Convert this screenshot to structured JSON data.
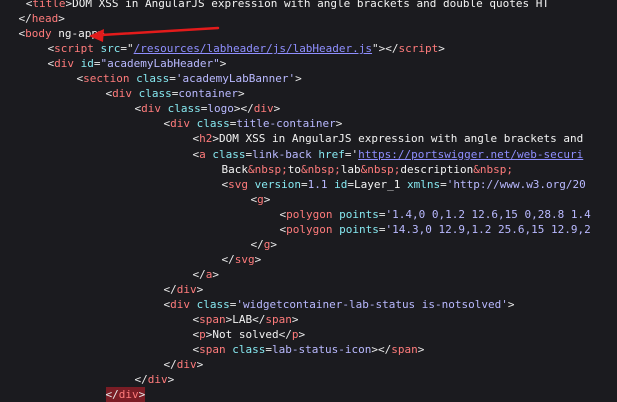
{
  "lines": [
    {
      "indent": 3,
      "name": "line-title",
      "tokens": [
        {
          "t": "punct",
          "v": "<"
        },
        {
          "t": "tag",
          "v": "title"
        },
        {
          "t": "punct",
          "v": ">"
        },
        {
          "t": "text",
          "v": "DOM XSS in AngularJS expression with angle brackets and double quotes HT"
        }
      ]
    },
    {
      "indent": 2,
      "name": "line-head-close",
      "tokens": [
        {
          "t": "punct",
          "v": "</"
        },
        {
          "t": "tag",
          "v": "head"
        },
        {
          "t": "punct",
          "v": ">"
        }
      ]
    },
    {
      "indent": 2,
      "name": "line-body-open",
      "tokens": [
        {
          "t": "punct",
          "v": "<"
        },
        {
          "t": "tag",
          "v": "body"
        },
        {
          "t": "text",
          "v": " ng-app"
        },
        {
          "t": "punct",
          "v": ">"
        }
      ]
    },
    {
      "indent": 6,
      "name": "line-script",
      "tokens": [
        {
          "t": "punct",
          "v": "<"
        },
        {
          "t": "tag",
          "v": "script"
        },
        {
          "t": "attr",
          "v": " src"
        },
        {
          "t": "punct",
          "v": "=\""
        },
        {
          "t": "link",
          "v": "/resources/labheader/js/labHeader.js"
        },
        {
          "t": "punct",
          "v": "\"></"
        },
        {
          "t": "tag",
          "v": "script"
        },
        {
          "t": "punct",
          "v": ">"
        }
      ]
    },
    {
      "indent": 6,
      "name": "line-div-academy",
      "tokens": [
        {
          "t": "punct",
          "v": "<"
        },
        {
          "t": "tag",
          "v": "div"
        },
        {
          "t": "attr",
          "v": " id"
        },
        {
          "t": "punct",
          "v": "="
        },
        {
          "t": "val",
          "v": "\"academyLabHeader\""
        },
        {
          "t": "punct",
          "v": ">"
        }
      ]
    },
    {
      "indent": 10,
      "name": "line-section",
      "tokens": [
        {
          "t": "punct",
          "v": "<"
        },
        {
          "t": "tag",
          "v": "section"
        },
        {
          "t": "attr",
          "v": " class"
        },
        {
          "t": "punct",
          "v": "="
        },
        {
          "t": "val",
          "v": "'academyLabBanner'"
        },
        {
          "t": "punct",
          "v": ">"
        }
      ]
    },
    {
      "indent": 14,
      "name": "line-div-container",
      "tokens": [
        {
          "t": "punct",
          "v": "<"
        },
        {
          "t": "tag",
          "v": "div"
        },
        {
          "t": "attr",
          "v": " class"
        },
        {
          "t": "punct",
          "v": "="
        },
        {
          "t": "val",
          "v": "container"
        },
        {
          "t": "punct",
          "v": ">"
        }
      ]
    },
    {
      "indent": 18,
      "name": "line-div-logo",
      "tokens": [
        {
          "t": "punct",
          "v": "<"
        },
        {
          "t": "tag",
          "v": "div"
        },
        {
          "t": "attr",
          "v": " class"
        },
        {
          "t": "punct",
          "v": "="
        },
        {
          "t": "val",
          "v": "logo"
        },
        {
          "t": "punct",
          "v": "></"
        },
        {
          "t": "tag",
          "v": "div"
        },
        {
          "t": "punct",
          "v": ">"
        }
      ]
    },
    {
      "indent": 22,
      "name": "line-div-title-container",
      "tokens": [
        {
          "t": "punct",
          "v": "<"
        },
        {
          "t": "tag",
          "v": "div"
        },
        {
          "t": "attr",
          "v": " class"
        },
        {
          "t": "punct",
          "v": "="
        },
        {
          "t": "val",
          "v": "title-container"
        },
        {
          "t": "punct",
          "v": ">"
        }
      ]
    },
    {
      "indent": 26,
      "name": "line-h2",
      "tokens": [
        {
          "t": "punct",
          "v": "<"
        },
        {
          "t": "tag",
          "v": "h2"
        },
        {
          "t": "punct",
          "v": ">"
        },
        {
          "t": "text",
          "v": "DOM XSS in AngularJS expression with angle brackets and"
        }
      ]
    },
    {
      "indent": 26,
      "name": "line-a-link-back",
      "tokens": [
        {
          "t": "punct",
          "v": "<"
        },
        {
          "t": "tag",
          "v": "a"
        },
        {
          "t": "attr",
          "v": " class"
        },
        {
          "t": "punct",
          "v": "="
        },
        {
          "t": "val",
          "v": "link-back"
        },
        {
          "t": "attr",
          "v": " href"
        },
        {
          "t": "punct",
          "v": "='"
        },
        {
          "t": "link",
          "v": "https://portswigger.net/web-securi"
        }
      ]
    },
    {
      "indent": 30,
      "name": "line-back-text",
      "tokens": [
        {
          "t": "text",
          "v": "Back"
        },
        {
          "t": "tag",
          "v": "&nbsp;"
        },
        {
          "t": "text",
          "v": "to"
        },
        {
          "t": "tag",
          "v": "&nbsp;"
        },
        {
          "t": "text",
          "v": "lab"
        },
        {
          "t": "tag",
          "v": "&nbsp;"
        },
        {
          "t": "text",
          "v": "description"
        },
        {
          "t": "tag",
          "v": "&nbsp;"
        }
      ]
    },
    {
      "indent": 30,
      "name": "line-svg",
      "tokens": [
        {
          "t": "punct",
          "v": "<"
        },
        {
          "t": "tag",
          "v": "svg"
        },
        {
          "t": "attr",
          "v": " version"
        },
        {
          "t": "punct",
          "v": "="
        },
        {
          "t": "val",
          "v": "1.1"
        },
        {
          "t": "attr",
          "v": " id"
        },
        {
          "t": "punct",
          "v": "="
        },
        {
          "t": "text",
          "v": "Layer_1"
        },
        {
          "t": "attr",
          "v": " xmlns"
        },
        {
          "t": "punct",
          "v": "="
        },
        {
          "t": "val",
          "v": "'http://www.w3.org/20"
        }
      ]
    },
    {
      "indent": 34,
      "name": "line-g-open",
      "tokens": [
        {
          "t": "punct",
          "v": "<"
        },
        {
          "t": "tag",
          "v": "g"
        },
        {
          "t": "punct",
          "v": ">"
        }
      ]
    },
    {
      "indent": 38,
      "name": "line-polygon-1",
      "tokens": [
        {
          "t": "punct",
          "v": "<"
        },
        {
          "t": "tag",
          "v": "polygon"
        },
        {
          "t": "attr",
          "v": " points"
        },
        {
          "t": "punct",
          "v": "="
        },
        {
          "t": "val",
          "v": "'1.4,0 0,1.2 12.6,15 0,28.8 1.4"
        }
      ]
    },
    {
      "indent": 38,
      "name": "line-polygon-2",
      "tokens": [
        {
          "t": "punct",
          "v": "<"
        },
        {
          "t": "tag",
          "v": "polygon"
        },
        {
          "t": "attr",
          "v": " points"
        },
        {
          "t": "punct",
          "v": "="
        },
        {
          "t": "val",
          "v": "'14.3,0 12.9,1.2 25.6,15 12.9,2"
        }
      ]
    },
    {
      "indent": 34,
      "name": "line-g-close",
      "tokens": [
        {
          "t": "punct",
          "v": "</"
        },
        {
          "t": "tag",
          "v": "g"
        },
        {
          "t": "punct",
          "v": ">"
        }
      ]
    },
    {
      "indent": 30,
      "name": "line-svg-close",
      "tokens": [
        {
          "t": "punct",
          "v": "</"
        },
        {
          "t": "tag",
          "v": "svg"
        },
        {
          "t": "punct",
          "v": ">"
        }
      ]
    },
    {
      "indent": 26,
      "name": "line-a-close",
      "tokens": [
        {
          "t": "punct",
          "v": "</"
        },
        {
          "t": "tag",
          "v": "a"
        },
        {
          "t": "punct",
          "v": ">"
        }
      ]
    },
    {
      "indent": 22,
      "name": "line-div-close-1",
      "tokens": [
        {
          "t": "punct",
          "v": "</"
        },
        {
          "t": "tag",
          "v": "div"
        },
        {
          "t": "punct",
          "v": ">"
        }
      ]
    },
    {
      "indent": 22,
      "name": "line-div-widget",
      "tokens": [
        {
          "t": "punct",
          "v": "<"
        },
        {
          "t": "tag",
          "v": "div"
        },
        {
          "t": "attr",
          "v": " class"
        },
        {
          "t": "punct",
          "v": "="
        },
        {
          "t": "val",
          "v": "'widgetcontainer-lab-status is-notsolved'"
        },
        {
          "t": "punct",
          "v": ">"
        }
      ]
    },
    {
      "indent": 26,
      "name": "line-span-lab",
      "tokens": [
        {
          "t": "punct",
          "v": "<"
        },
        {
          "t": "tag",
          "v": "span"
        },
        {
          "t": "punct",
          "v": ">"
        },
        {
          "t": "text",
          "v": "LAB"
        },
        {
          "t": "punct",
          "v": "</"
        },
        {
          "t": "tag",
          "v": "span"
        },
        {
          "t": "punct",
          "v": ">"
        }
      ]
    },
    {
      "indent": 26,
      "name": "line-p-not-solved",
      "tokens": [
        {
          "t": "punct",
          "v": "<"
        },
        {
          "t": "tag",
          "v": "p"
        },
        {
          "t": "punct",
          "v": ">"
        },
        {
          "t": "text",
          "v": "Not solved"
        },
        {
          "t": "punct",
          "v": "</"
        },
        {
          "t": "tag",
          "v": "p"
        },
        {
          "t": "punct",
          "v": ">"
        }
      ]
    },
    {
      "indent": 26,
      "name": "line-span-icon",
      "tokens": [
        {
          "t": "punct",
          "v": "<"
        },
        {
          "t": "tag",
          "v": "span"
        },
        {
          "t": "attr",
          "v": " class"
        },
        {
          "t": "punct",
          "v": "="
        },
        {
          "t": "val",
          "v": "lab-status-icon"
        },
        {
          "t": "punct",
          "v": "></"
        },
        {
          "t": "tag",
          "v": "span"
        },
        {
          "t": "punct",
          "v": ">"
        }
      ]
    },
    {
      "indent": 22,
      "name": "line-div-close-2",
      "tokens": [
        {
          "t": "punct",
          "v": "</"
        },
        {
          "t": "tag",
          "v": "div"
        },
        {
          "t": "punct",
          "v": ">"
        }
      ]
    },
    {
      "indent": 18,
      "name": "line-div-close-3",
      "tokens": [
        {
          "t": "punct",
          "v": "</"
        },
        {
          "t": "tag",
          "v": "div"
        },
        {
          "t": "punct",
          "v": ">"
        }
      ]
    },
    {
      "indent": 14,
      "name": "line-div-close-4",
      "highlight": true,
      "tokens": [
        {
          "t": "punct",
          "v": "</"
        },
        {
          "t": "tag",
          "v": "div"
        },
        {
          "t": "punct",
          "v": ">"
        }
      ]
    }
  ],
  "colors": {
    "background": "#1b1b1f",
    "tag": "#ff7b7b",
    "attribute": "#86e8f0",
    "value": "#b9b9ff",
    "link": "#8f8fff",
    "text": "#f3f3f3",
    "highlight": "#7a1d25",
    "arrow": "#e31b1b"
  },
  "annotation": {
    "type": "arrow",
    "color": "#e31b1b",
    "target_line": "line-body-open"
  }
}
